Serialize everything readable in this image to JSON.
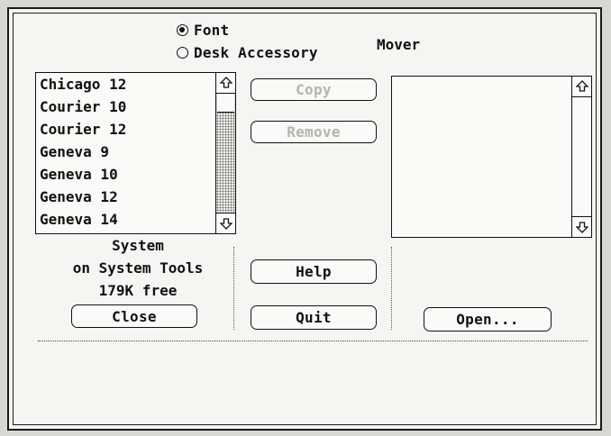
{
  "options": {
    "font_label": "Font",
    "font_selected": true,
    "desk_accessory_label": "Desk Accessory",
    "desk_accessory_selected": false
  },
  "mover_title": "Mover",
  "font_list": {
    "items": [
      "Chicago 12",
      "Courier 10",
      "Courier 12",
      "Geneva 9",
      "Geneva 10",
      "Geneva 12",
      "Geneva 14"
    ]
  },
  "buttons": {
    "copy": "Copy",
    "remove": "Remove",
    "help": "Help",
    "quit": "Quit",
    "close": "Close",
    "open": "Open..."
  },
  "source_info": {
    "file": "System",
    "disk": "on System Tools",
    "free": "179K free"
  },
  "icons": {
    "scroll_up": "scroll-up-arrow-icon",
    "scroll_down": "scroll-down-arrow-icon"
  },
  "colors": {
    "dialog_bg": "#f6f5f1",
    "frame": "#1a1a1a",
    "dimmed_text": "#b5b3ad"
  }
}
